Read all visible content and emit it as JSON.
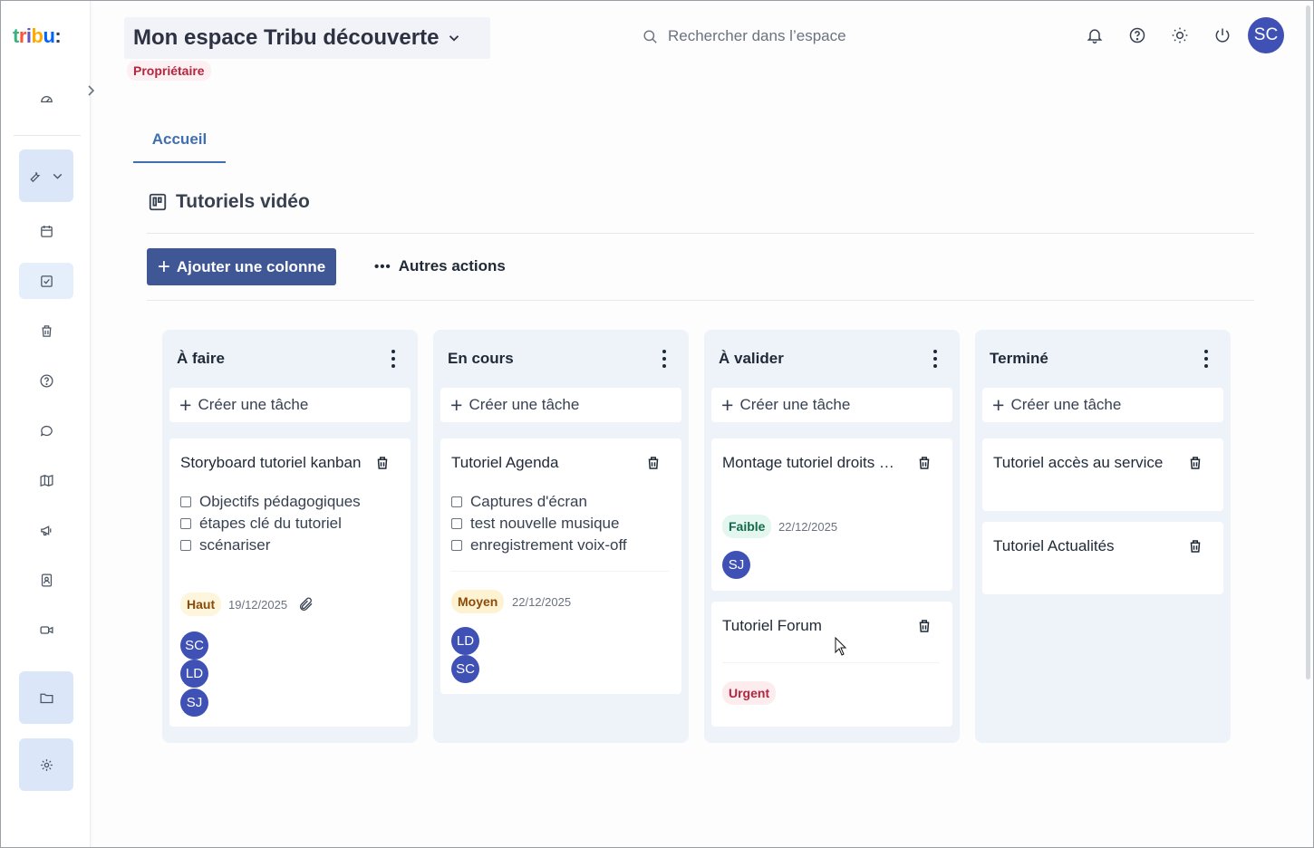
{
  "app": {
    "logo_parts": [
      "t",
      "r",
      "i",
      "b",
      "u",
      ":"
    ],
    "space_title": "Mon espace Tribu découverte",
    "role": "Propriétaire",
    "user_initials": "SC"
  },
  "search": {
    "placeholder": "Rechercher dans l’espace"
  },
  "header_icons": [
    "bell-icon",
    "help-icon",
    "theme-sun-icon",
    "power-icon"
  ],
  "sidebar": {
    "items": [
      "dashboard-icon",
      "tools-icon",
      "calendar-icon",
      "tasks-icon",
      "trash-icon",
      "help-icon",
      "chat-icon",
      "map-icon",
      "megaphone-icon",
      "contacts-icon",
      "video-icon",
      "folder-icon",
      "settings-icon"
    ]
  },
  "tabs": [
    {
      "label": "Accueil",
      "active": true
    }
  ],
  "board": {
    "title": "Tutoriels vidéo",
    "add_column_label": "Ajouter une colonne",
    "more_actions_label": "Autres actions",
    "create_task_label": "Créer une tâche",
    "columns": [
      {
        "title": "À faire",
        "cards": [
          {
            "title": "Storyboard tutoriel kanban",
            "checklist": [
              "Objectifs pédagogiques",
              "étapes clé du tutoriel",
              "scénariser"
            ],
            "priority": "Haut",
            "date": "19/12/2025",
            "attachment": true,
            "assignees": [
              "SC",
              "LD",
              "SJ"
            ]
          }
        ]
      },
      {
        "title": "En cours",
        "cards": [
          {
            "title": "Tutoriel Agenda",
            "checklist": [
              "Captures d'écran",
              "test nouvelle musique",
              "enregistrement voix-off"
            ],
            "priority": "Moyen",
            "date": "22/12/2025",
            "assignees": [
              "LD",
              "SC"
            ]
          }
        ]
      },
      {
        "title": "À valider",
        "cards": [
          {
            "title": "Montage tutoriel droits d'accès",
            "priority": "Faible",
            "date": "22/12/2025",
            "assignees": [
              "SJ"
            ]
          },
          {
            "title": "Tutoriel Forum",
            "priority": "Urgent"
          }
        ]
      },
      {
        "title": "Terminé",
        "cards": [
          {
            "title": "Tutoriel accès au service"
          },
          {
            "title": "Tutoriel Actualités"
          }
        ]
      }
    ]
  },
  "colors": {
    "primary": "#3f5794",
    "avatar": "#3f51b5",
    "tab_active": "#3f6fb0",
    "column_bg": "#eef3fa",
    "role_badge": "#b3263e"
  }
}
